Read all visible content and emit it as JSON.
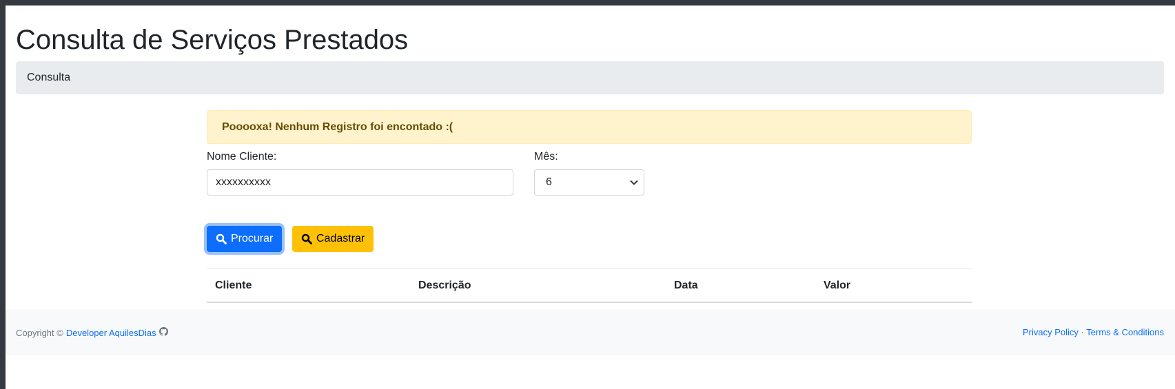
{
  "header": {
    "title": "Consulta de Serviços Prestados"
  },
  "breadcrumb": {
    "label": "Consulta"
  },
  "alert": {
    "message": "Pooooxa! Nenhum Registro foi encontado :("
  },
  "form": {
    "client_label": "Nome Cliente:",
    "client_value": "xxxxxxxxxx",
    "month_label": "Mês:",
    "month_value": "6",
    "search_button": "Procurar",
    "register_button": "Cadastrar"
  },
  "table": {
    "columns": [
      "Cliente",
      "Descrição",
      "Data",
      "Valor"
    ],
    "rows": []
  },
  "footer": {
    "copyright": "Copyright ©",
    "developer_link": "Developer AquilesDias",
    "privacy": "Privacy Policy",
    "separator": "·",
    "terms": "Terms & Conditions"
  },
  "colors": {
    "primary": "#0d6efd",
    "warning": "#ffc107",
    "alert_bg": "#fff3cd",
    "alert_text": "#664d03"
  }
}
